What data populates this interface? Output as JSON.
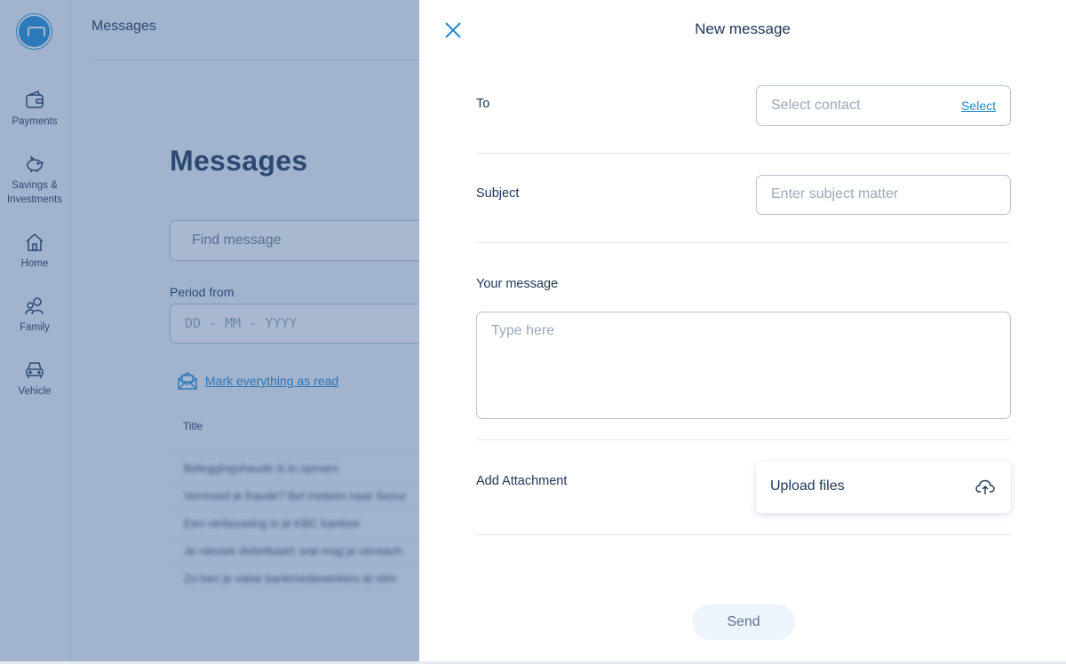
{
  "sidebar": {
    "items": [
      {
        "label": "Payments",
        "icon": "wallet-icon"
      },
      {
        "label": "Savings & Investments",
        "icon": "piggy-bank-icon"
      },
      {
        "label": "Home",
        "icon": "house-icon"
      },
      {
        "label": "Family",
        "icon": "people-icon"
      },
      {
        "label": "Vehicle",
        "icon": "car-icon"
      }
    ]
  },
  "topbar": {
    "title": "Messages"
  },
  "messages_page": {
    "title": "Messages",
    "search_placeholder": "Find message",
    "period_label": "Period from",
    "date_placeholder": "DD - MM - YYYY",
    "mark_read_label": "Mark everything as read",
    "column_title": "Title",
    "rows": [
      "Beleggingshaude is in opmars",
      "Vermoed je fraude? Bel meteen naar Secur",
      "Een verbouwing in je KBC kantoor",
      "Je nieuwe debetkaart: wat mag je verwach",
      "Zo ben je valse bankmedewerkers te slim"
    ]
  },
  "new_message": {
    "title": "New message",
    "to_label": "To",
    "to_placeholder": "Select contact",
    "select_label": "Select",
    "subject_label": "Subject",
    "subject_placeholder": "Enter subject matter",
    "message_label": "Your message",
    "message_placeholder": "Type here",
    "attachment_label": "Add Attachment",
    "upload_label": "Upload files",
    "send_label": "Send"
  },
  "colors": {
    "accent": "#1e88cf",
    "text": "#1d3557",
    "overlay": "#3e6296"
  }
}
